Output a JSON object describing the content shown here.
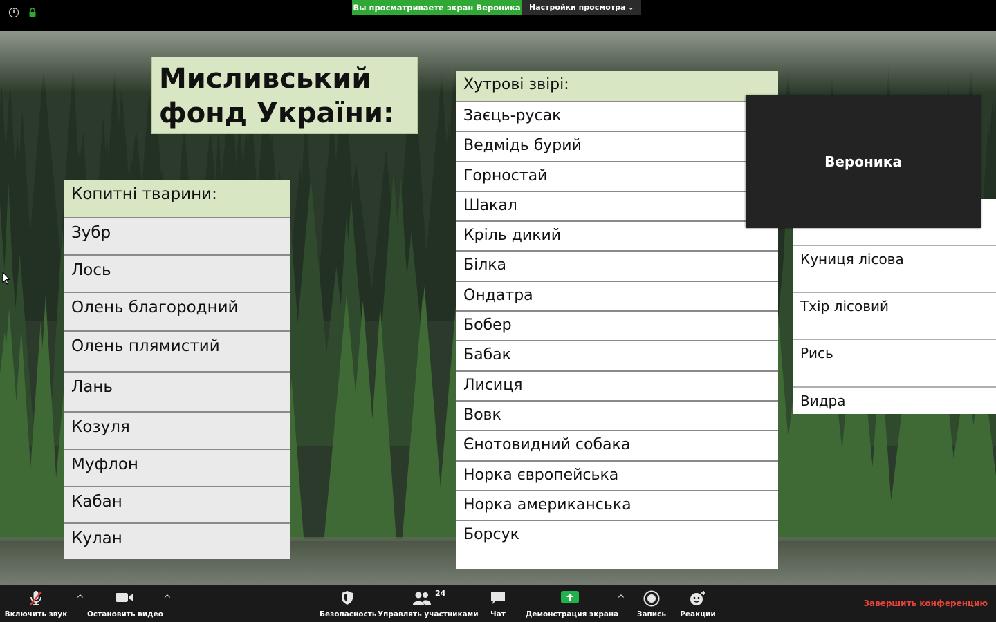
{
  "topbar": {
    "viewing_banner": "Вы просматриваете экран Вероника",
    "view_options": "Настройки просмотра"
  },
  "slide": {
    "title": "Мисливський фонд України:",
    "hoofed": {
      "header": "Копитні тварини:",
      "items": [
        "Зубр",
        "Лось",
        "Олень благородний",
        "Олень плямистий",
        "Лань",
        "Козуля",
        "Муфлон",
        "Кабан",
        "Кулан"
      ]
    },
    "fur": {
      "header": "Хутрові звірі:",
      "items": [
        "Заєць-русак",
        "Ведмідь бурий",
        "Горностай",
        "Шакал",
        "Кріль дикий",
        "Білка",
        "Ондатра",
        "Бобер",
        "Бабак",
        "Лисиця",
        "Вовк",
        "Єнотовидний собака",
        "Норка європейська",
        "Норка американська",
        "Борсук"
      ]
    },
    "fur_continued": {
      "items": [
        "Куниця лісова",
        "Тхір  лісовий",
        "Рись",
        "Видра"
      ]
    }
  },
  "video_tile": {
    "name": "Вероника"
  },
  "toolbar": {
    "mic_label": "Включить звук",
    "video_label": "Остановить видео",
    "security_label": "Безопасность",
    "participants_label": "Управлять участниками",
    "participants_count": "24",
    "chat_label": "Чат",
    "share_label": "Демонстрация экрана",
    "record_label": "Запись",
    "reactions_label": "Реакции",
    "end_label": "Завершить конференцию"
  },
  "colors": {
    "banner_green": "#2fa836",
    "slide_header_green": "#d9e6c3",
    "end_red": "#e8433a",
    "share_green": "#23b14d",
    "mic_muted_red": "#e23b3b"
  }
}
